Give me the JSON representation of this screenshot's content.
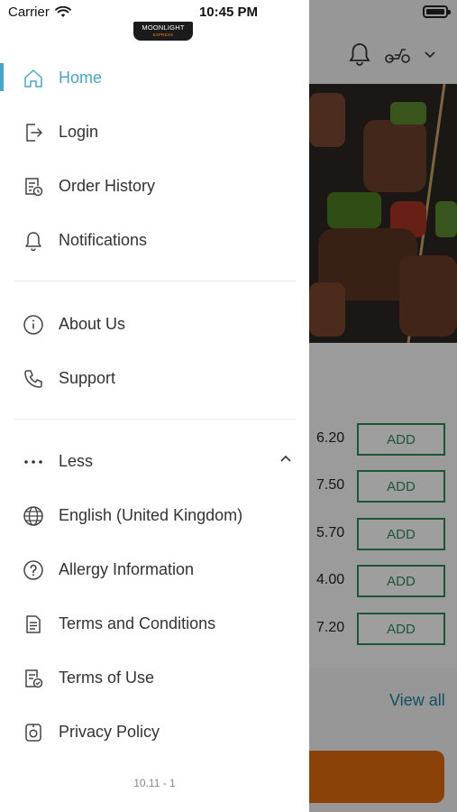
{
  "status_bar": {
    "carrier": "Carrier",
    "time": "10:45 PM"
  },
  "logo": {
    "text": "MOONLIGHT",
    "subtext": "EXPRESS"
  },
  "menu": {
    "primary": [
      {
        "label": "Home",
        "icon": "home-icon",
        "active": true
      },
      {
        "label": "Login",
        "icon": "login-icon"
      },
      {
        "label": "Order History",
        "icon": "order-history-icon"
      },
      {
        "label": "Notifications",
        "icon": "bell-icon"
      }
    ],
    "secondary": [
      {
        "label": "About Us",
        "icon": "info-icon"
      },
      {
        "label": "Support",
        "icon": "phone-icon"
      }
    ],
    "less": {
      "label": "Less",
      "icon": "more-dots-icon"
    },
    "extra": [
      {
        "label": "English (United Kingdom)",
        "icon": "globe-icon"
      },
      {
        "label": "Allergy Information",
        "icon": "question-icon"
      },
      {
        "label": "Terms and Conditions",
        "icon": "document-icon"
      },
      {
        "label": "Terms of Use",
        "icon": "document-check-icon"
      },
      {
        "label": "Privacy Policy",
        "icon": "privacy-icon"
      }
    ]
  },
  "version": "10.11 - 1",
  "background": {
    "prices": [
      "6.20",
      "7.50",
      "5.70",
      "4.00",
      "7.20"
    ],
    "add_label": "ADD",
    "view_all": "View all"
  },
  "colors": {
    "accent": "#4aa3c8",
    "add_green": "#2e8b57",
    "order_orange": "#e06b10"
  }
}
